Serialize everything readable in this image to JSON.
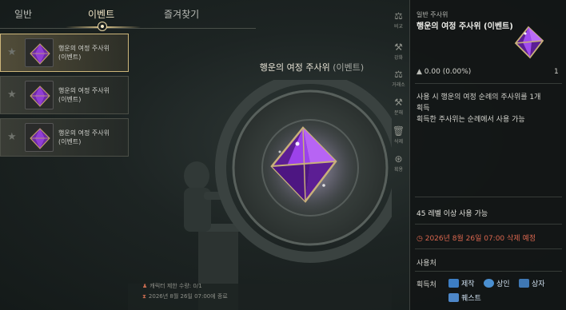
{
  "tabs": {
    "general": "일반",
    "event": "이벤트",
    "favorites": "즐겨찾기"
  },
  "items": [
    {
      "name_line1": "행운의 여정 주사위",
      "name_line2": "(이벤트)"
    },
    {
      "name_line1": "행운의 여정 주사위",
      "name_line2": "(이벤트)"
    },
    {
      "name_line1": "행운의 여정 주사위",
      "name_line2": "(이벤트)"
    }
  ],
  "center": {
    "title_main": "행운의 여정 주사위",
    "title_sub": "(이벤트)",
    "footer_limit": "캐릭터 제한 수량: 0/1",
    "footer_expire": "2026년 8월 26일 07:00에 종료"
  },
  "sidebar": [
    {
      "icon": "scale-icon",
      "glyph": "⚖",
      "label": "비교"
    },
    {
      "icon": "anvil-icon",
      "glyph": "⚒",
      "label": "강화"
    },
    {
      "icon": "trade-icon",
      "glyph": "⚖",
      "label": "거래소"
    },
    {
      "icon": "hammer-icon",
      "glyph": "⚒",
      "label": "분해"
    },
    {
      "icon": "trash-icon",
      "glyph": "🗑",
      "label": "삭제"
    },
    {
      "icon": "gift-icon",
      "glyph": "⊛",
      "label": "획용"
    }
  ],
  "detail": {
    "category": "일반 주사위",
    "title": "행운의 여정 주사위 (이벤트)",
    "stat": "0.00 (0.00%)",
    "count": "1",
    "desc_line1": "사용 시 행운의 여정 순례의 주사위를 1개",
    "desc_line2": "획득",
    "desc_line3": "획득한 주사위는 순례에서 사용 가능",
    "level_req": "45 레벨 이상 사용 가능",
    "expire": "2026년 8월 26일 07:00 삭제 예정",
    "use_label": "사용처",
    "acquire_label": "획득처",
    "sources": [
      "제작",
      "상인",
      "상자",
      "퀘스트"
    ]
  },
  "colors": {
    "accent_gold": "#cdb67a",
    "expire_red": "#d9664e",
    "gem_purple": "#8a2bd6"
  }
}
